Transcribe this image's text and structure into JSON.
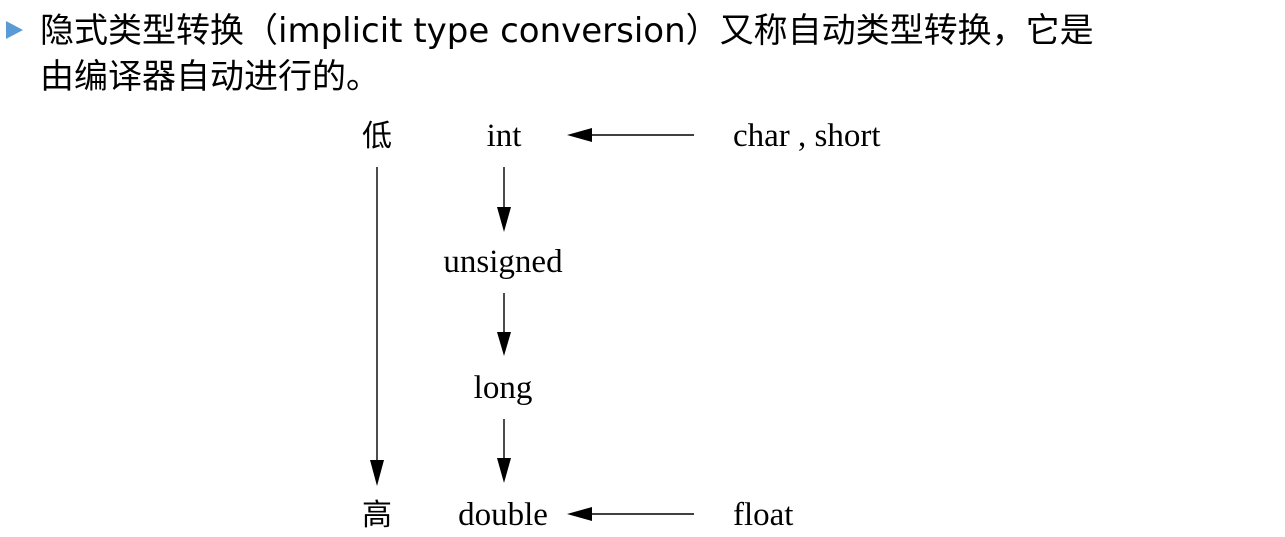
{
  "text": {
    "line1": "隐式类型转换（implicit type conversion）又称自动类型转换，它是",
    "line2": "由编译器自动进行的。"
  },
  "diagram": {
    "low_label": "低",
    "high_label": "高",
    "nodes": {
      "int": "int",
      "unsigned": "unsigned",
      "long": "long",
      "double": "double",
      "char_short": "char , short",
      "float": "float"
    }
  },
  "colors": {
    "bullet": "#5b9bd5",
    "text": "#000000"
  }
}
